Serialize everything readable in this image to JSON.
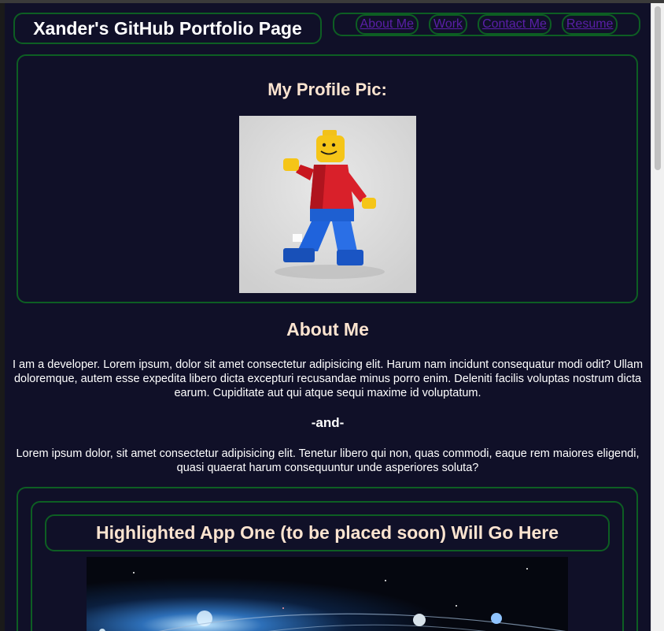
{
  "site_title": "Xander's GitHub Portfolio Page",
  "nav": [
    "About Me",
    "Work",
    "Contact Me",
    "Resume"
  ],
  "profile": {
    "heading": "My Profile Pic:"
  },
  "about": {
    "heading": "About Me",
    "paragraph1": "I am a developer. Lorem ipsum, dolor sit amet consectetur adipisicing elit. Harum nam incidunt consequatur modi odit? Ullam doloremque, autem esse expedita libero dicta excepturi recusandae minus porro enim. Deleniti facilis voluptas nostrum dicta earum. Cupiditate aut qui atque sequi maxime id voluptatum.",
    "separator": "-and-",
    "paragraph2": "Lorem ipsum dolor, sit amet consectetur adipisicing elit. Tenetur libero qui non, quas commodi, eaque rem maiores eligendi, quasi quaerat harum consequuntur unde asperiores soluta?"
  },
  "highlight": {
    "heading": "Highlighted App One (to be placed soon) Will Go Here"
  },
  "colors": {
    "background": "#101028",
    "border": "#0d5e23",
    "heading": "#fce4d0",
    "link": "#5a1fa8"
  }
}
